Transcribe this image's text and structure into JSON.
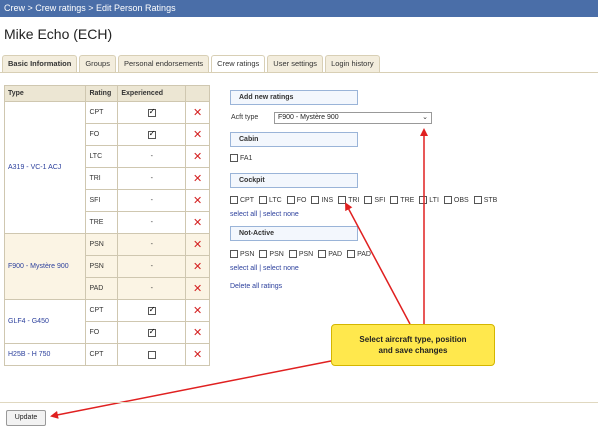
{
  "breadcrumb": "Crew > Crew ratings > Edit Person Ratings",
  "person_name": "Mike Echo (ECH)",
  "tabs": [
    {
      "label": "Basic Information"
    },
    {
      "label": "Groups"
    },
    {
      "label": "Personal endorsements"
    },
    {
      "label": "Crew ratings"
    },
    {
      "label": "User settings"
    },
    {
      "label": "Login history"
    }
  ],
  "table": {
    "headers": [
      "Type",
      "Rating",
      "Experienced"
    ],
    "groups": [
      {
        "type": "A319 - VC-1 ACJ",
        "rows": [
          {
            "rating": "CPT",
            "experienced": "checked"
          },
          {
            "rating": "FO",
            "experienced": "checked"
          },
          {
            "rating": "LTC",
            "experienced": "-"
          },
          {
            "rating": "TRI",
            "experienced": "-"
          },
          {
            "rating": "SFI",
            "experienced": "-"
          },
          {
            "rating": "TRE",
            "experienced": "-"
          }
        ]
      },
      {
        "type": "F900 - Mystère 900",
        "rows": [
          {
            "rating": "PSN",
            "experienced": "-"
          },
          {
            "rating": "PSN",
            "experienced": "-"
          },
          {
            "rating": "PAD",
            "experienced": "-"
          }
        ]
      },
      {
        "type": "GLF4 - G450",
        "rows": [
          {
            "rating": "CPT",
            "experienced": "checked"
          },
          {
            "rating": "FO",
            "experienced": "checked"
          }
        ]
      },
      {
        "type": "H25B - H 750",
        "rows": [
          {
            "rating": "CPT",
            "experienced": "unchecked"
          }
        ]
      }
    ]
  },
  "form": {
    "add_new_ratings": "Add new ratings",
    "acft_type_label": "Acft type",
    "acft_type_value": "F900 - Mystère 900",
    "cabin_label": "Cabin",
    "cabin_options": [
      "FA1"
    ],
    "cockpit_label": "Cockpit",
    "cockpit_options": [
      "CPT",
      "LTC",
      "FO",
      "INS",
      "TRI",
      "SFI",
      "TRE",
      "LTI",
      "OBS",
      "STB"
    ],
    "select_all": "select all",
    "separator": "|",
    "select_none": "select none",
    "not_active_label": "Not-Active",
    "not_active_options": [
      "PSN",
      "PSN",
      "PSN",
      "PAD",
      "PAD"
    ],
    "delete_all": "Delete all ratings"
  },
  "callout": {
    "line1": "Select aircraft type, position",
    "line2": "and save changes"
  },
  "update_button": "Update",
  "colors": {
    "header_bar": "#4a6ea8",
    "delete": "#d42020",
    "callout": "#ffe84d",
    "arrow": "#e02020",
    "link": "#2b3f9c"
  }
}
